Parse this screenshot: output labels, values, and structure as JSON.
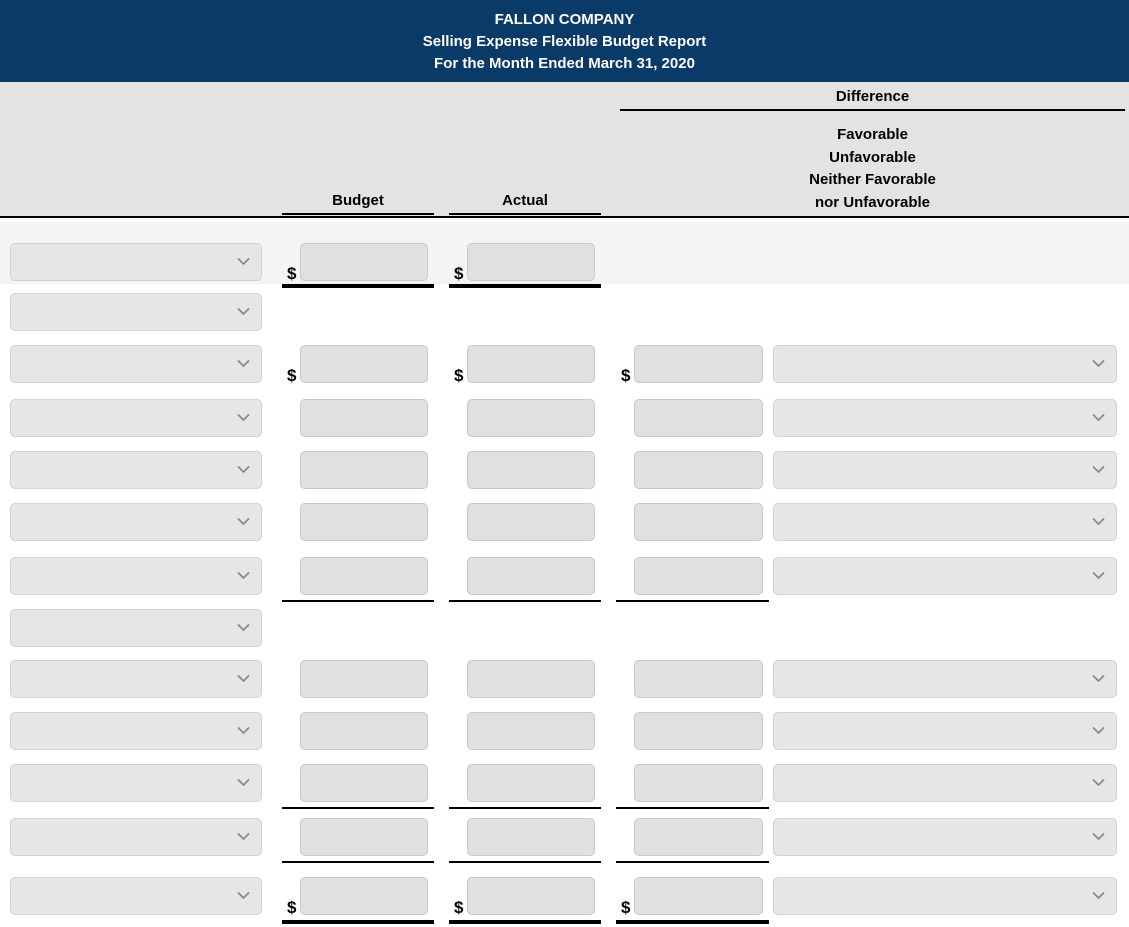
{
  "report": {
    "company": "FALLON COMPANY",
    "statement": "Selling Expense Flexible Budget Report",
    "period": "For the Month Ended March 31, 2020"
  },
  "columns": {
    "budget": "Budget",
    "actual": "Actual",
    "difference": "Difference",
    "difference_options_label": "Favorable\nUnfavorable\nNeither Favorable\nnor Unfavorable",
    "difference_line_1": "Favorable",
    "difference_line_2": "Unfavorable",
    "difference_line_3": "Neither Favorable",
    "difference_line_4": "nor Unfavorable"
  },
  "symbols": {
    "currency": "$",
    "chevron": "chevron-down-icon"
  },
  "colors": {
    "title_bar": "#0a3a68",
    "header_bg": "#e3e3e3",
    "row_shade": "#f4f4f4",
    "field_bg": "#e0e0e0",
    "select_bg": "#e6e6e6",
    "rule": "#000000"
  },
  "rows": [
    {
      "id": 1,
      "label_value": "",
      "label_placeholder": "",
      "budget": "",
      "actual": "",
      "difference_amount": "",
      "difference_choice": ""
    },
    {
      "id": 2,
      "label_value": "",
      "label_placeholder": "",
      "budget": null,
      "actual": null,
      "difference_amount": null,
      "difference_choice": null
    },
    {
      "id": 3,
      "label_value": "",
      "label_placeholder": "",
      "budget": "",
      "actual": "",
      "difference_amount": "",
      "difference_choice": ""
    },
    {
      "id": 4,
      "label_value": "",
      "label_placeholder": "",
      "budget": "",
      "actual": "",
      "difference_amount": "",
      "difference_choice": ""
    },
    {
      "id": 5,
      "label_value": "",
      "label_placeholder": "",
      "budget": "",
      "actual": "",
      "difference_amount": "",
      "difference_choice": ""
    },
    {
      "id": 6,
      "label_value": "",
      "label_placeholder": "",
      "budget": "",
      "actual": "",
      "difference_amount": "",
      "difference_choice": ""
    },
    {
      "id": 7,
      "label_value": "",
      "label_placeholder": "",
      "budget": "",
      "actual": "",
      "difference_amount": "",
      "difference_choice": ""
    },
    {
      "id": 8,
      "label_value": "",
      "label_placeholder": "",
      "budget": null,
      "actual": null,
      "difference_amount": null,
      "difference_choice": null
    },
    {
      "id": 9,
      "label_value": "",
      "label_placeholder": "",
      "budget": "",
      "actual": "",
      "difference_amount": "",
      "difference_choice": ""
    },
    {
      "id": 10,
      "label_value": "",
      "label_placeholder": "",
      "budget": "",
      "actual": "",
      "difference_amount": "",
      "difference_choice": ""
    },
    {
      "id": 11,
      "label_value": "",
      "label_placeholder": "",
      "budget": "",
      "actual": "",
      "difference_amount": "",
      "difference_choice": ""
    },
    {
      "id": 12,
      "label_value": "",
      "label_placeholder": "",
      "budget": "",
      "actual": "",
      "difference_amount": "",
      "difference_choice": ""
    },
    {
      "id": 13,
      "label_value": "",
      "label_placeholder": "",
      "budget": "",
      "actual": "",
      "difference_amount": "",
      "difference_choice": ""
    }
  ]
}
